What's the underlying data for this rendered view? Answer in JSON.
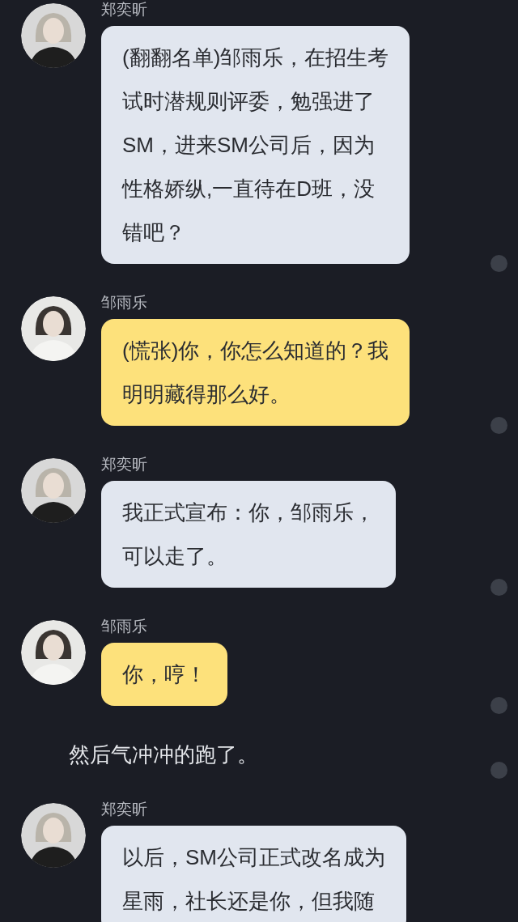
{
  "messages": [
    {
      "kind": "chat",
      "sender": "郑奕昕",
      "color": "#e1e6ef",
      "lines": [
        "(翻翻名单)邹雨乐，在招生考",
        "试时潜规则评委，勉强进了",
        "SM，进来SM公司后，因为",
        "性格娇纵,一直待在D班，没",
        "错吧？"
      ],
      "selected": false
    },
    {
      "kind": "chat",
      "sender": "邹雨乐",
      "color": "#fde17b",
      "lines": [
        "(慌张)你，你怎么知道的？我",
        "明明藏得那么好。"
      ],
      "selected": false
    },
    {
      "kind": "chat",
      "sender": "郑奕昕",
      "color": "#e1e6ef",
      "lines": [
        "我正式宣布：你，邹雨乐，",
        "可以走了。"
      ],
      "selected": false
    },
    {
      "kind": "chat",
      "sender": "邹雨乐",
      "color": "#fde17b",
      "lines": [
        "你，哼！"
      ],
      "selected": false
    },
    {
      "kind": "narration",
      "text": "然后气冲冲的跑了。",
      "selected": false
    },
    {
      "kind": "chat",
      "sender": "郑奕昕",
      "color": "#e1e6ef",
      "lines": [
        "以后，SM公司正式改名成为",
        "星雨，社长还是你，但我随"
      ]
    }
  ]
}
